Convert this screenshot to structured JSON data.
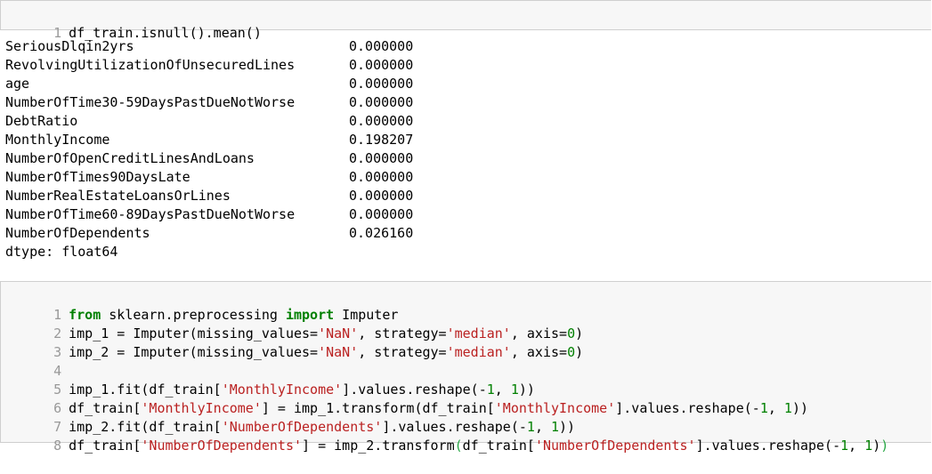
{
  "cell1": {
    "line_number": "1",
    "code": "df_train.isnull().mean()"
  },
  "output": {
    "rows": [
      {
        "name": "SeriousDlqin2yrs",
        "value": "0.000000"
      },
      {
        "name": "RevolvingUtilizationOfUnsecuredLines",
        "value": "0.000000"
      },
      {
        "name": "age",
        "value": "0.000000"
      },
      {
        "name": "NumberOfTime30-59DaysPastDueNotWorse",
        "value": "0.000000"
      },
      {
        "name": "DebtRatio",
        "value": "0.000000"
      },
      {
        "name": "MonthlyIncome",
        "value": "0.198207"
      },
      {
        "name": "NumberOfOpenCreditLinesAndLoans",
        "value": "0.000000"
      },
      {
        "name": "NumberOfTimes90DaysLate",
        "value": "0.000000"
      },
      {
        "name": "NumberRealEstateLoansOrLines",
        "value": "0.000000"
      },
      {
        "name": "NumberOfTime60-89DaysPastDueNotWorse",
        "value": "0.000000"
      },
      {
        "name": "NumberOfDependents",
        "value": "0.026160"
      }
    ],
    "dtype": "dtype: float64"
  },
  "cell2": {
    "line_numbers": [
      "1",
      "2",
      "3",
      "4",
      "5",
      "6",
      "7",
      "8"
    ],
    "l1": {
      "kw1": "from",
      "mid": " sklearn.preprocessing ",
      "kw2": "import",
      "rest": " Imputer"
    },
    "l2": {
      "a": "imp_1 = Imputer(missing_values=",
      "s1": "'NaN'",
      "b": ", strategy=",
      "s2": "'median'",
      "c": ", axis=",
      "n": "0",
      "d": ")"
    },
    "l3": {
      "a": "imp_2 = Imputer(missing_values=",
      "s1": "'NaN'",
      "b": ", strategy=",
      "s2": "'median'",
      "c": ", axis=",
      "n": "0",
      "d": ")"
    },
    "l5": {
      "a": "imp_1.fit(df_train[",
      "s1": "'MonthlyIncome'",
      "b": "].values.reshape(-",
      "n1": "1",
      "c": ", ",
      "n2": "1",
      "d": "))"
    },
    "l6": {
      "a": "df_train[",
      "s1": "'MonthlyIncome'",
      "b": "] = imp_1.transform(df_train[",
      "s2": "'MonthlyIncome'",
      "c": "].values.reshape(-",
      "n1": "1",
      "d": ", ",
      "n2": "1",
      "e": "))"
    },
    "l7": {
      "a": "imp_2.fit(df_train[",
      "s1": "'NumberOfDependents'",
      "b": "].values.reshape(-",
      "n1": "1",
      "c": ", ",
      "n2": "1",
      "d": "))"
    },
    "l8": {
      "a": "df_train[",
      "s1": "'NumberOfDependents'",
      "b": "] = imp_2.transform",
      "p1": "(",
      "c": "df_train[",
      "s2": "'NumberOfDependents'",
      "d": "].values.reshape(-",
      "n1": "1",
      "e": ", ",
      "n2": "1",
      "f": ")",
      "p2": ")"
    }
  }
}
